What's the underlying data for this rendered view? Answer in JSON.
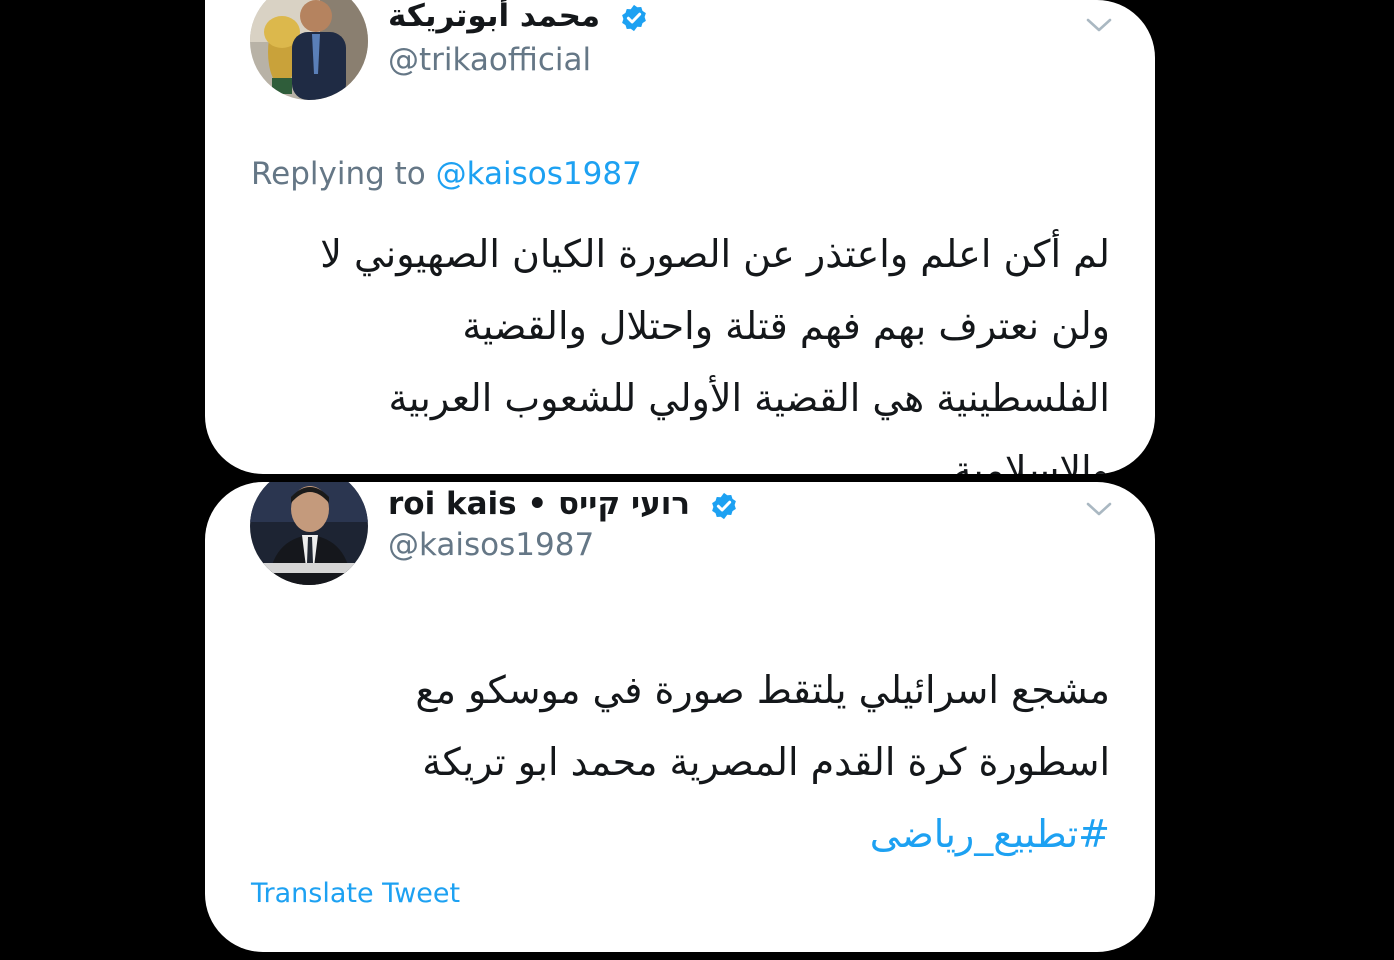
{
  "tweet_reply": {
    "display_name": "محمد أبوتريكة",
    "handle": "@trikaofficial",
    "replying_prefix": "Replying to",
    "replying_to": "@kaisos1987",
    "body_lines": [
      "لم أكن اعلم واعتذر عن الصورة الكيان الصهيوني لا",
      "ولن نعترف بهم فهم قتلة واحتلال والقضية",
      "الفلسطينية هي القضية الأولي للشعوب العربية",
      "والاسلامية"
    ],
    "verified_icon": "verified-badge-icon",
    "menu_icon": "chevron-down-icon"
  },
  "tweet_original": {
    "display_name": "roi kais • רועי קייס",
    "handle": "@kaisos1987",
    "body_lines": [
      "مشجع اسرائيلي يلتقط صورة في موسكو مع",
      "اسطورة كرة القدم المصرية محمد ابو تريكة"
    ],
    "hashtag": "#تطبيع_رياضى",
    "translate_label": "Translate Tweet",
    "verified_icon": "verified-badge-icon",
    "menu_icon": "chevron-down-icon"
  },
  "colors": {
    "background": "#000000",
    "card": "#ffffff",
    "accent": "#1da1f2",
    "text_primary": "#14171a",
    "text_secondary": "#657786"
  }
}
